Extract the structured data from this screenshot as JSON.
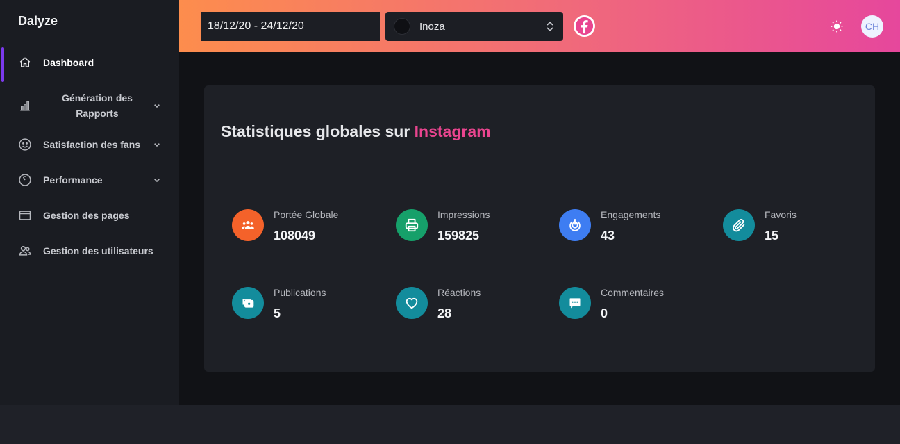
{
  "app": {
    "name": "Dalyze"
  },
  "sidebar": {
    "items": [
      {
        "label": "Dashboard",
        "icon": "home-icon",
        "active": true
      },
      {
        "label": "Génération des Rapports",
        "icon": "bar-chart-icon",
        "expandable": true
      },
      {
        "label": "Satisfaction des fans",
        "icon": "smile-icon",
        "expandable": true
      },
      {
        "label": "Performance",
        "icon": "gauge-icon",
        "expandable": true
      },
      {
        "label": "Gestion des pages",
        "icon": "browser-window-icon"
      },
      {
        "label": "Gestion des utilisateurs",
        "icon": "users-icon"
      }
    ]
  },
  "topbar": {
    "date_range": "18/12/20 - 24/12/20",
    "page_select": {
      "value": "Inoza"
    },
    "network_icon": "facebook-icon",
    "theme_icon": "sun-icon",
    "avatar_initials": "CH",
    "gradient": [
      "#fd8d4d",
      "#e6479c"
    ]
  },
  "card": {
    "title_prefix": "Statistiques globales sur",
    "title_accent": "Instagram",
    "accent_color": "#e9458f"
  },
  "stats": [
    {
      "label": "Portée Globale",
      "value": "108049",
      "icon": "group-icon",
      "color": "#f4622a"
    },
    {
      "label": "Impressions",
      "value": "159825",
      "icon": "printer-icon",
      "color": "#16a06a"
    },
    {
      "label": "Engagements",
      "value": "43",
      "icon": "fire-icon",
      "color": "#3e7df2"
    },
    {
      "label": "Favoris",
      "value": "15",
      "icon": "paperclip-icon",
      "color": "#138c9c"
    },
    {
      "label": "Publications",
      "value": "5",
      "icon": "media-icon",
      "color": "#138c9c"
    },
    {
      "label": "Réactions",
      "value": "28",
      "icon": "heart-icon",
      "color": "#138c9c"
    },
    {
      "label": "Commentaires",
      "value": "0",
      "icon": "comment-icon",
      "color": "#138c9c"
    }
  ]
}
